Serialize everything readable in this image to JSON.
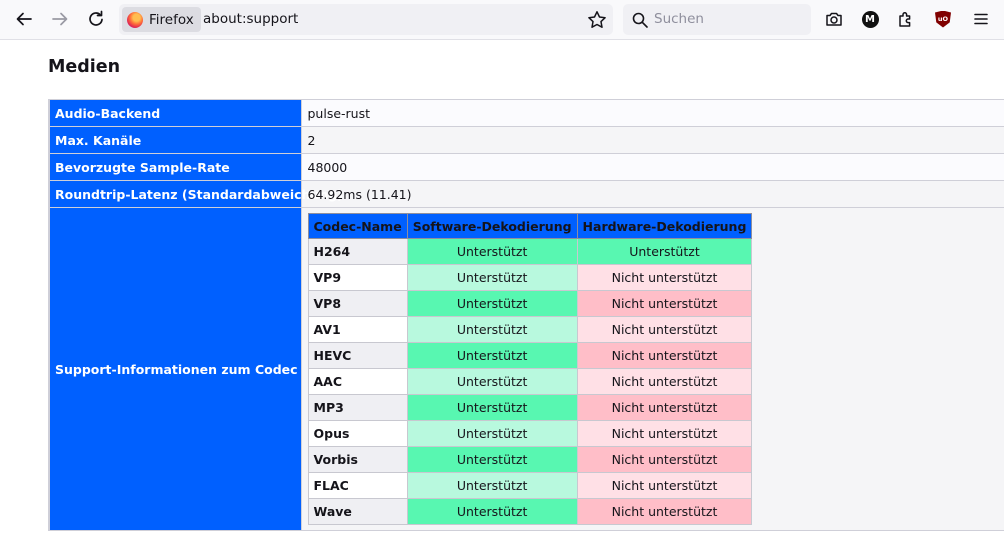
{
  "browser": {
    "identity_label": "Firefox",
    "url": "about:support",
    "search_placeholder": "Suchen",
    "extension_m_letter": "M",
    "extension_ub_letters": "uO"
  },
  "section": {
    "title": "Medien"
  },
  "rows": [
    {
      "label": "Audio-Backend",
      "value": "pulse-rust"
    },
    {
      "label": "Max. Kanäle",
      "value": "2"
    },
    {
      "label": "Bevorzugte Sample-Rate",
      "value": "48000"
    },
    {
      "label": "Roundtrip-Latenz (Standardabweichung)",
      "value": "64.92ms (11.41)"
    }
  ],
  "codec": {
    "label": "Support-Informationen zum Codec",
    "headers": [
      "Codec-Name",
      "Software-Dekodierung",
      "Hardware-Dekodierung"
    ],
    "items": [
      {
        "name": "H264",
        "sw": "Unterstützt",
        "hw": "Unterstützt"
      },
      {
        "name": "VP9",
        "sw": "Unterstützt",
        "hw": "Nicht unterstützt"
      },
      {
        "name": "VP8",
        "sw": "Unterstützt",
        "hw": "Nicht unterstützt"
      },
      {
        "name": "AV1",
        "sw": "Unterstützt",
        "hw": "Nicht unterstützt"
      },
      {
        "name": "HEVC",
        "sw": "Unterstützt",
        "hw": "Nicht unterstützt"
      },
      {
        "name": "AAC",
        "sw": "Unterstützt",
        "hw": "Nicht unterstützt"
      },
      {
        "name": "MP3",
        "sw": "Unterstützt",
        "hw": "Nicht unterstützt"
      },
      {
        "name": "Opus",
        "sw": "Unterstützt",
        "hw": "Nicht unterstützt"
      },
      {
        "name": "Vorbis",
        "sw": "Unterstützt",
        "hw": "Nicht unterstützt"
      },
      {
        "name": "FLAC",
        "sw": "Unterstützt",
        "hw": "Nicht unterstützt"
      },
      {
        "name": "Wave",
        "sw": "Unterstützt",
        "hw": "Nicht unterstützt"
      }
    ]
  },
  "colors": {
    "label_bg": "#0060ff",
    "supported_strong": "#58f7b1",
    "supported_light": "#b8f9de",
    "unsupported_strong": "#ffbec8",
    "unsupported_light": "#ffe0e6",
    "name_alt_bg": "#efeff3"
  }
}
